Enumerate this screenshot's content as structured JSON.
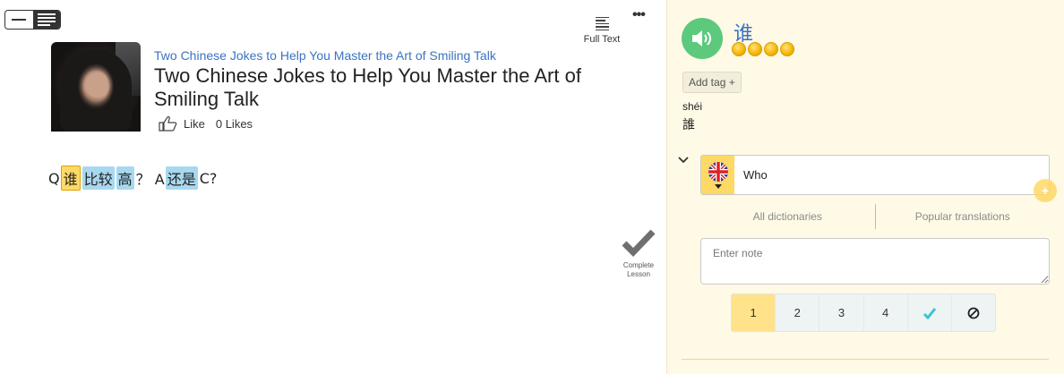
{
  "reader": {
    "view_toggle": {
      "options": [
        "single-line-icon",
        "lines-icon"
      ],
      "active": "lines-icon"
    },
    "full_text": {
      "label": "Full Text",
      "icon": "document-lines-icon"
    },
    "more_icon": "more-dots-icon",
    "lesson": {
      "subtitle": "Two Chinese Jokes to Help You Master the Art of Smiling Talk",
      "title": "Two Chinese Jokes to Help You Master the Art of Smiling Talk",
      "like_label": "Like",
      "likes_count": "0 Likes"
    },
    "sentence": {
      "lead": "Q",
      "words": [
        {
          "text": "谁",
          "state": "selected"
        },
        {
          "text": "比较",
          "state": "known"
        },
        {
          "text": "高",
          "state": "known"
        }
      ],
      "mid": "？ A",
      "word_after": {
        "text": "还是",
        "state": "known"
      },
      "tail": "C?"
    },
    "complete_lesson": {
      "label_line1": "Complete",
      "label_line2": "Lesson",
      "icon": "checkmark-icon"
    }
  },
  "panel": {
    "headword": "谁",
    "frequency_coins": 4,
    "add_tag_label": "Add tag +",
    "pinyin": "shéi",
    "traditional": "誰",
    "translation": {
      "language_flag": "uk-flag-icon",
      "value": "Who"
    },
    "dictionary_tabs": [
      "All dictionaries",
      "Popular translations"
    ],
    "note_placeholder": "Enter note",
    "levels": [
      "1",
      "2",
      "3",
      "4"
    ],
    "active_level": "1",
    "known_icon": "check-icon",
    "ignore_icon": "ignore-icon",
    "colors": {
      "panel_bg": "#fefae6",
      "accent_yellow": "#ffd966",
      "speaker_green": "#5cc97d",
      "link_blue": "#3a73c2",
      "known_blue": "#a8d8ef",
      "check_teal": "#36c4d6"
    }
  }
}
